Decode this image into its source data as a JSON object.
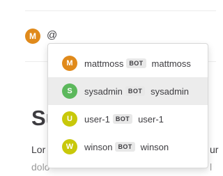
{
  "composer": {
    "avatar_initial": "M",
    "avatar_color": "#e08a1b",
    "text": "@"
  },
  "post": {
    "heading_partial": "Su",
    "line1_start": "Lor",
    "line1_end": "ur",
    "line2_partial": "dolo",
    "line2_end": "l"
  },
  "mention_list": {
    "items": [
      {
        "initial": "M",
        "color": "#e08a1b",
        "username": "mattmoss",
        "badge": "BOT",
        "display_name": "mattmoss",
        "selected": false
      },
      {
        "initial": "S",
        "color": "#5cb85c",
        "username": "sysadmin",
        "badge": "BOT",
        "display_name": "sysadmin",
        "selected": true
      },
      {
        "initial": "U",
        "color": "#c8c80a",
        "username": "user-1",
        "badge": "BOT",
        "display_name": "user-1",
        "selected": false
      },
      {
        "initial": "W",
        "color": "#c8c80a",
        "username": "winson",
        "badge": "BOT",
        "display_name": "winson",
        "selected": false
      }
    ]
  }
}
